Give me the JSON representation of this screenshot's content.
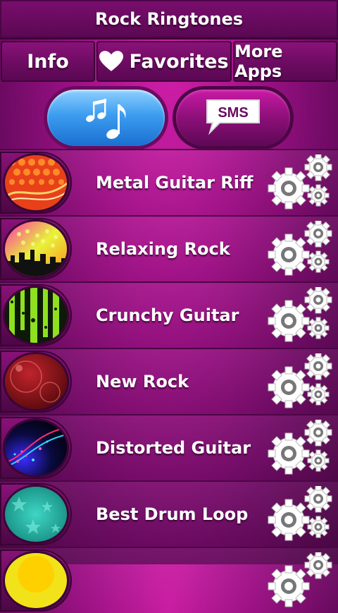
{
  "app": {
    "title": "Rock Ringtones"
  },
  "menu": {
    "info_label": "Info",
    "favorites_label": "Favorites",
    "more_apps_label": "More Apps"
  },
  "toggles": {
    "sms_label": "SMS"
  },
  "ringtones": [
    {
      "name": "Metal Guitar Riff",
      "thumb": "orange-dots"
    },
    {
      "name": "Relaxing Rock",
      "thumb": "yellow-city"
    },
    {
      "name": "Crunchy Guitar",
      "thumb": "green-stripes"
    },
    {
      "name": "New Rock",
      "thumb": "red-bubbles"
    },
    {
      "name": "Distorted Guitar",
      "thumb": "blue-lights"
    },
    {
      "name": "Best Drum Loop",
      "thumb": "teal-stars"
    },
    {
      "name": "",
      "thumb": "yellow-partial"
    }
  ],
  "colors": {
    "accent": "#b0168f",
    "music_active": "#3c9df0"
  },
  "icons": [
    "heart-icon",
    "music-notes-icon",
    "sms-icon",
    "settings-gear-icon"
  ]
}
